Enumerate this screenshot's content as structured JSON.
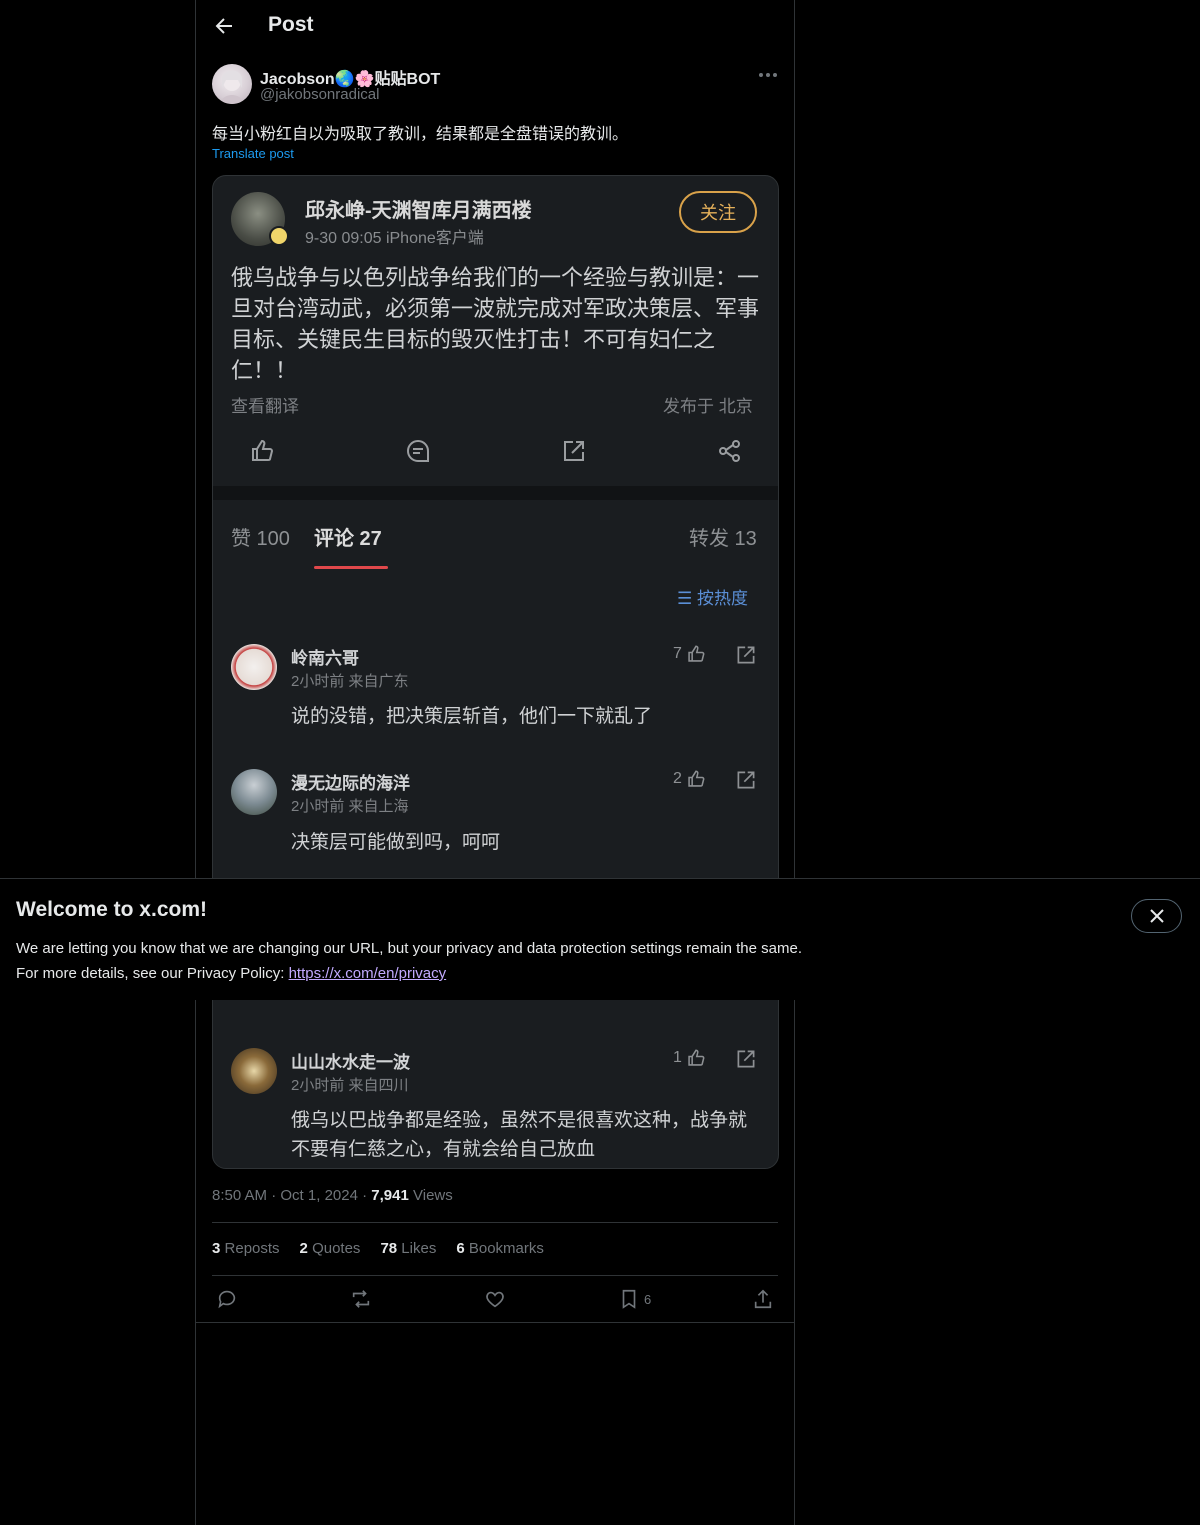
{
  "header": {
    "title": "Post"
  },
  "post": {
    "display_name": "Jacobson🌏🌸贴贴BOT",
    "handle": "@jakobsonradical",
    "text": "每当小粉红自以为吸取了教训，结果都是全盘错误的教训。",
    "translate_label": "Translate post",
    "time": "8:50 AM",
    "date": "Oct 1, 2024",
    "views_count": "7,941",
    "views_label": "Views",
    "stats": {
      "reposts_count": "3",
      "reposts_label": "Reposts",
      "quotes_count": "2",
      "quotes_label": "Quotes",
      "likes_count": "78",
      "likes_label": "Likes",
      "bookmarks_count": "6",
      "bookmarks_label": "Bookmarks"
    },
    "action_bar": {
      "bookmark_count": "6"
    }
  },
  "embedded_image": {
    "author": "邱永峥-天渊智库月满西楼",
    "meta": "9-30 09:05    iPhone客户端",
    "follow_label": "关注",
    "body": "俄乌战争与以色列战争给我们的一个经验与教训是：一旦对台湾动武，必须第一波就完成对军政决策层、军事目标、关键民生目标的毁灭性打击！不可有妇仁之仁！！",
    "translate_label": "查看翻译",
    "location": "发布于 北京",
    "tabs": {
      "likes": "赞 100",
      "comments": "评论 27",
      "reposts": "转发 13"
    },
    "sort_label": "按热度",
    "comments": [
      {
        "name": "岭南六哥",
        "meta": "2小时前   来自广东",
        "text": "说的没错，把决策层斩首，他们一下就乱了",
        "likes": "7"
      },
      {
        "name": "漫无边际的海洋",
        "meta": "2小时前   来自上海",
        "text": "决策层可能做到吗，呵呵",
        "likes": "2"
      },
      {
        "name": "山山水水走一波",
        "meta": "2小时前   来自四川",
        "text": "俄乌以巴战争都是经验，虽然不是很喜欢这种，战争就不要有仁慈之心，有就会给自己放血",
        "likes": "1"
      }
    ]
  },
  "cookie_banner": {
    "title": "Welcome to x.com!",
    "line1": "We are letting you know that we are changing our URL, but your privacy and data protection settings remain the same.",
    "line2_prefix": "For more details, see our Privacy Policy: ",
    "link": "https://x.com/en/privacy"
  }
}
